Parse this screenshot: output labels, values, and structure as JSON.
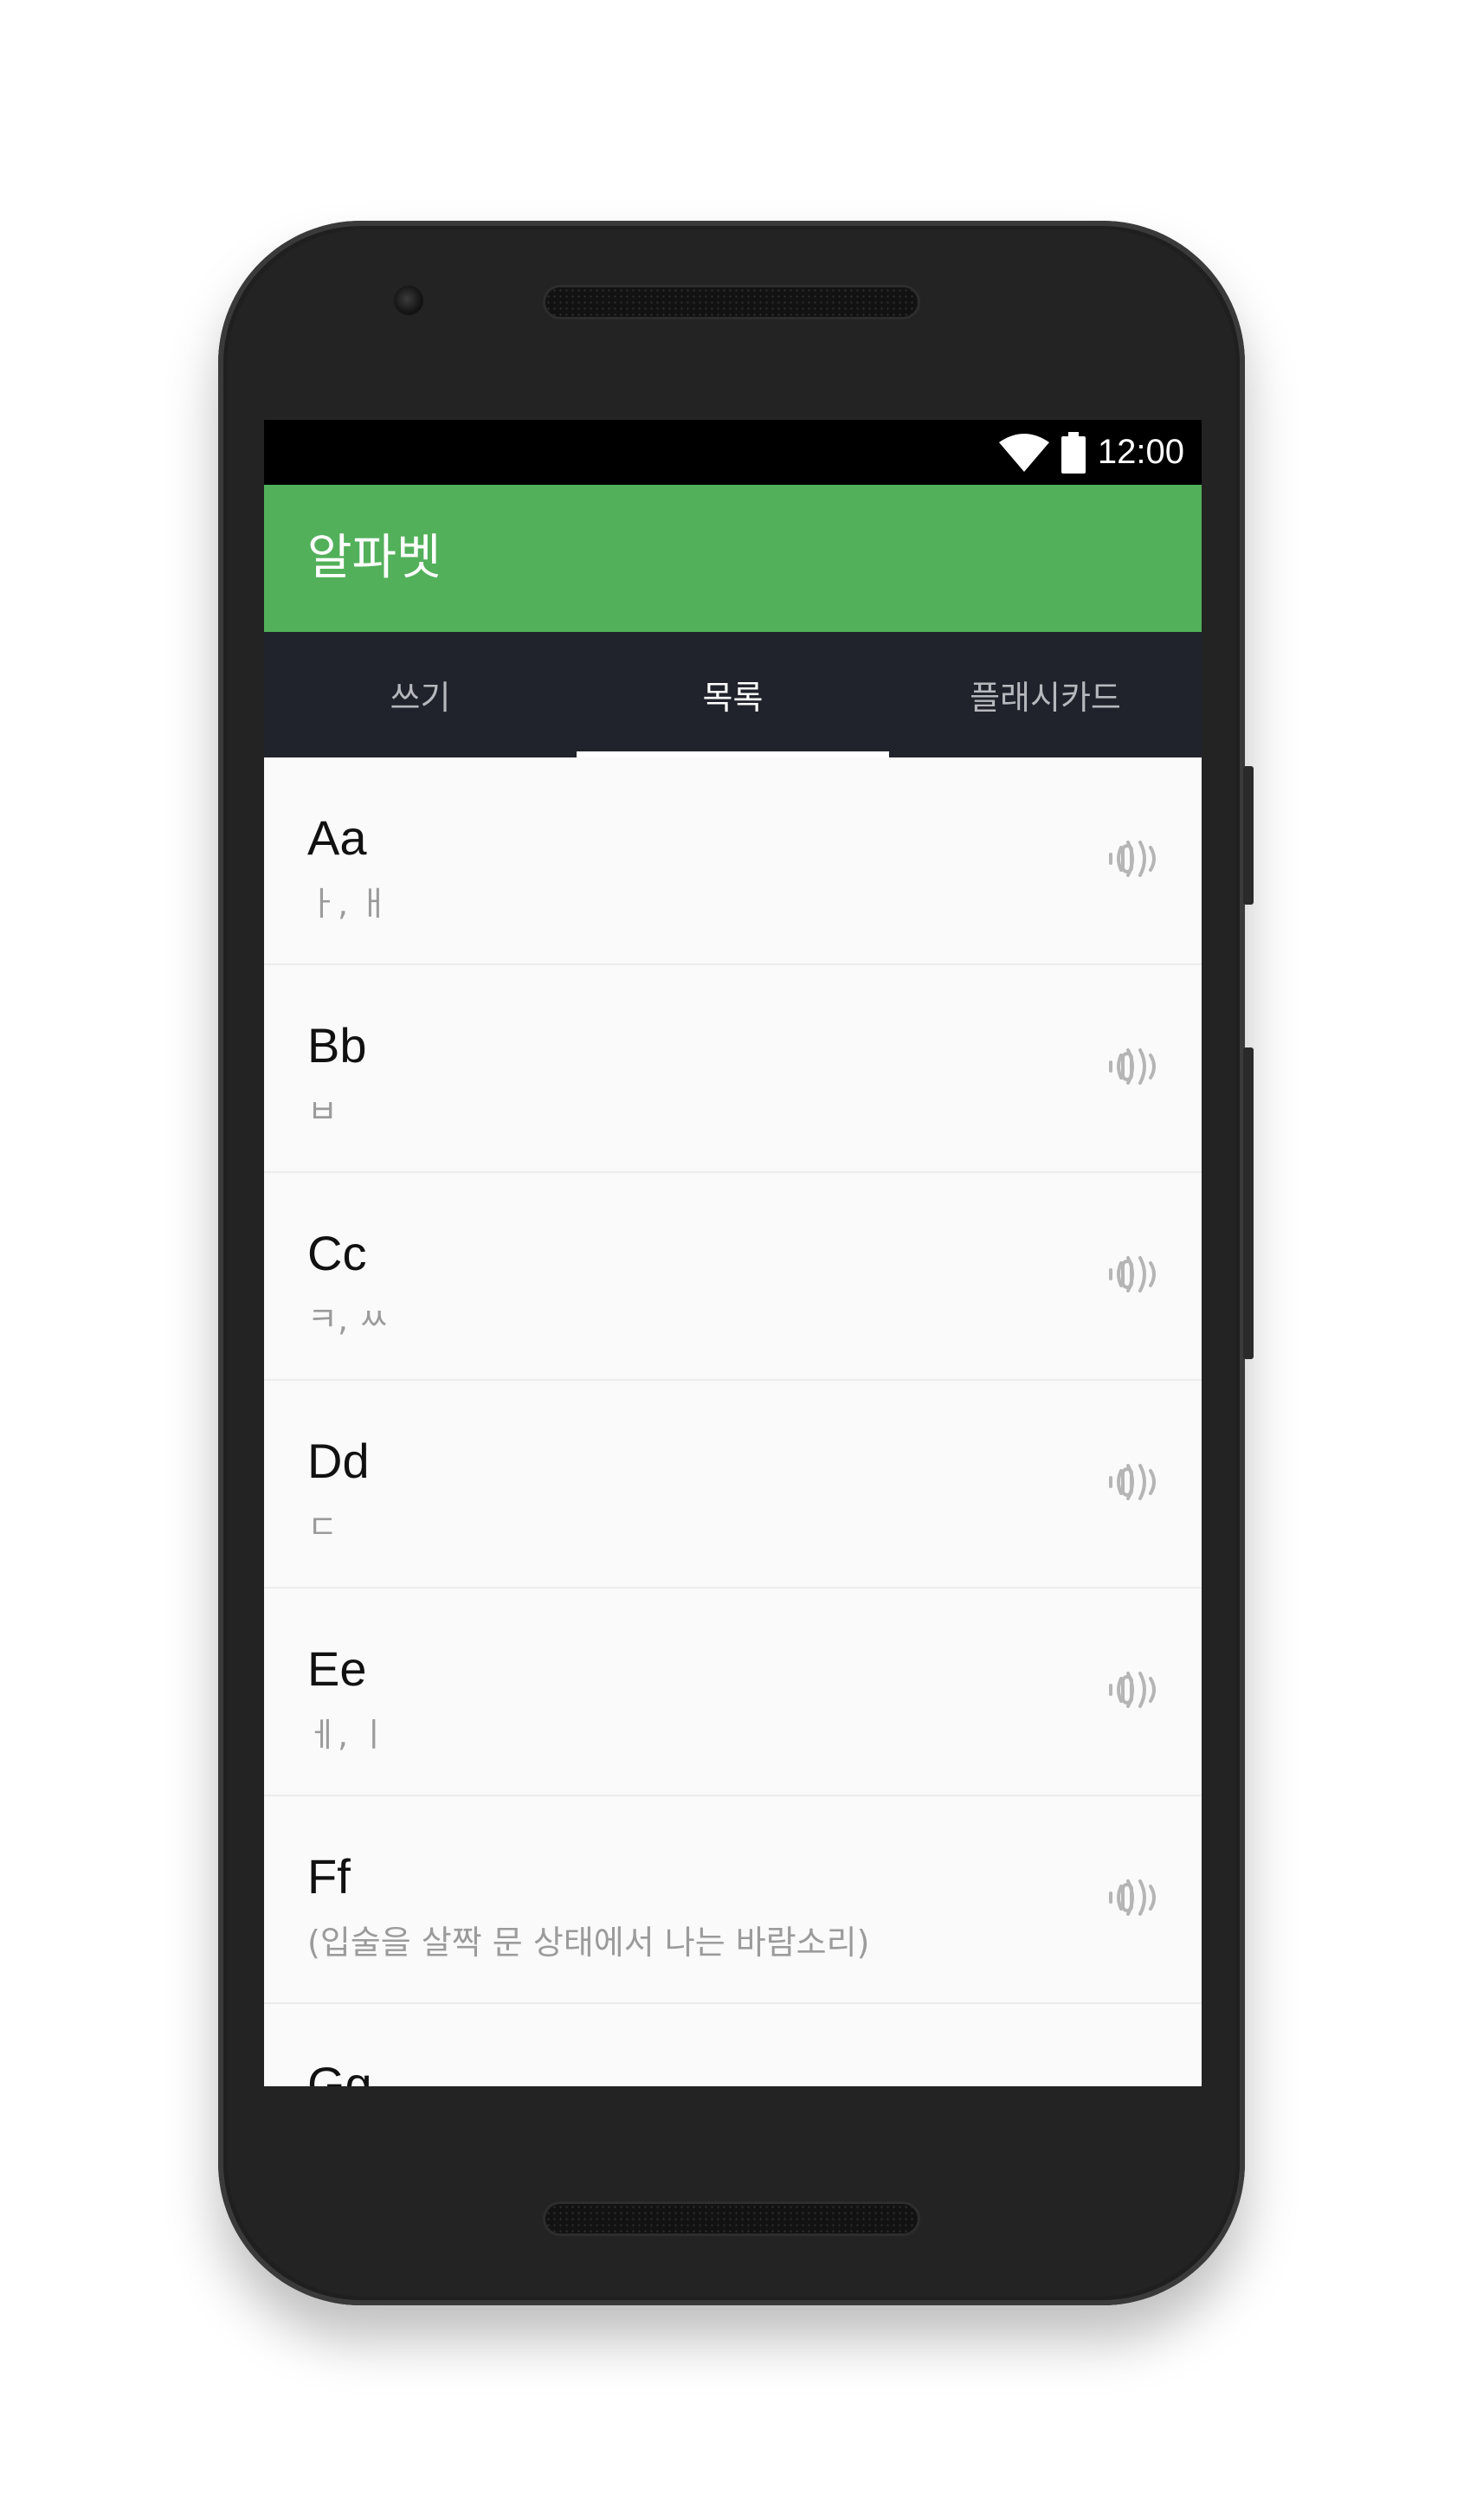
{
  "status_bar": {
    "time": "12:00",
    "icons": [
      "wifi-icon",
      "battery-icon"
    ]
  },
  "app_bar": {
    "title": "알파벳",
    "color": "#52b05a"
  },
  "tabs": [
    {
      "label": "쓰기",
      "active": false
    },
    {
      "label": "목록",
      "active": true
    },
    {
      "label": "플래시카드",
      "active": false
    }
  ],
  "items": [
    {
      "letter": "Aa",
      "pronunciation": "ㅏ, ㅐ",
      "icon": "speaker-icon"
    },
    {
      "letter": "Bb",
      "pronunciation": "ㅂ",
      "icon": "speaker-icon"
    },
    {
      "letter": "Cc",
      "pronunciation": "ㅋ, ㅆ",
      "icon": "speaker-icon"
    },
    {
      "letter": "Dd",
      "pronunciation": "ㄷ",
      "icon": "speaker-icon"
    },
    {
      "letter": "Ee",
      "pronunciation": "ㅔ, ㅣ",
      "icon": "speaker-icon"
    },
    {
      "letter": "Ff",
      "pronunciation": "(입술을 살짝 문 상태에서 나는 바람소리)",
      "icon": "speaker-icon"
    },
    {
      "letter": "Gg",
      "pronunciation": "",
      "icon": "speaker-icon"
    }
  ]
}
